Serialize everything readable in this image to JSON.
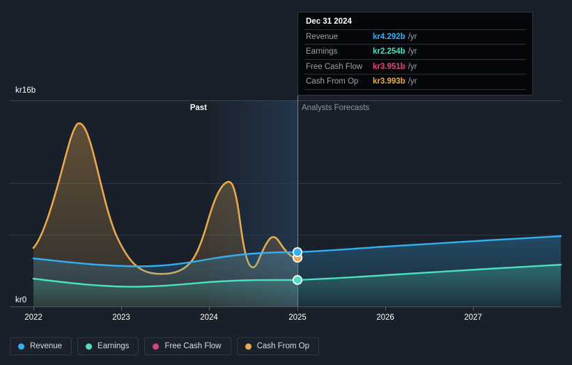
{
  "chart_data": {
    "type": "area",
    "title": "",
    "currency_prefix": "kr",
    "xlabel": "",
    "ylabel": "",
    "ylim": [
      0,
      16
    ],
    "xlim": [
      2021.75,
      2027.8
    ],
    "grid": true,
    "y_ticks": [
      {
        "value": 16,
        "label": "kr16b"
      },
      {
        "value": 0,
        "label": "kr0"
      }
    ],
    "x_ticks": [
      {
        "value": 2022,
        "label": "2022"
      },
      {
        "value": 2023,
        "label": "2023"
      },
      {
        "value": 2024,
        "label": "2024"
      },
      {
        "value": 2025,
        "label": "2025"
      },
      {
        "value": 2026,
        "label": "2026"
      },
      {
        "value": 2027,
        "label": "2027"
      }
    ],
    "divider": {
      "value": 2025,
      "past_label": "Past",
      "forecast_label": "Analysts Forecasts"
    },
    "legend_position": "bottom-left",
    "series": [
      {
        "name": "Revenue",
        "color": "#35aef2",
        "values": [
          {
            "x": 2021.93,
            "y": 3.65
          },
          {
            "x": 2022.35,
            "y": 3.5
          },
          {
            "x": 2022.8,
            "y": 3.34
          },
          {
            "x": 2023.2,
            "y": 3.3
          },
          {
            "x": 2023.6,
            "y": 3.48
          },
          {
            "x": 2024.0,
            "y": 3.76
          },
          {
            "x": 2024.5,
            "y": 4.05
          },
          {
            "x": 2025.0,
            "y": 4.292
          },
          {
            "x": 2025.6,
            "y": 4.4
          },
          {
            "x": 2026.2,
            "y": 4.62
          },
          {
            "x": 2027.0,
            "y": 4.92
          },
          {
            "x": 2027.8,
            "y": 5.2
          }
        ]
      },
      {
        "name": "Earnings",
        "color": "#4ddfc0",
        "values": [
          {
            "x": 2021.93,
            "y": 2.0
          },
          {
            "x": 2022.4,
            "y": 1.83
          },
          {
            "x": 2022.9,
            "y": 1.74
          },
          {
            "x": 2023.4,
            "y": 1.76
          },
          {
            "x": 2023.9,
            "y": 1.88
          },
          {
            "x": 2024.4,
            "y": 2.02
          },
          {
            "x": 2025.0,
            "y": 2.254
          },
          {
            "x": 2025.7,
            "y": 2.33
          },
          {
            "x": 2026.4,
            "y": 2.47
          },
          {
            "x": 2027.2,
            "y": 2.67
          },
          {
            "x": 2027.8,
            "y": 2.82
          }
        ]
      },
      {
        "name": "Free Cash Flow",
        "color": "#d6457f",
        "values": [
          {
            "x": 2025.0,
            "y": 3.951
          }
        ]
      },
      {
        "name": "Cash From Op",
        "color": "#e8a94f",
        "values": [
          {
            "x": 2021.93,
            "y": 4.55
          },
          {
            "x": 2022.1,
            "y": 6.2
          },
          {
            "x": 2022.28,
            "y": 12.55
          },
          {
            "x": 2022.45,
            "y": 11.2
          },
          {
            "x": 2022.7,
            "y": 7.9
          },
          {
            "x": 2022.95,
            "y": 4.2
          },
          {
            "x": 2023.15,
            "y": 2.55
          },
          {
            "x": 2023.45,
            "y": 2.52
          },
          {
            "x": 2023.72,
            "y": 3.6
          },
          {
            "x": 2023.95,
            "y": 7.8
          },
          {
            "x": 2024.1,
            "y": 9.5
          },
          {
            "x": 2024.26,
            "y": 9.7
          },
          {
            "x": 2024.38,
            "y": 7.2
          },
          {
            "x": 2024.52,
            "y": 3.3
          },
          {
            "x": 2024.6,
            "y": 2.95
          },
          {
            "x": 2024.76,
            "y": 5.2
          },
          {
            "x": 2024.88,
            "y": 4.6
          },
          {
            "x": 2025.0,
            "y": 3.993
          }
        ]
      }
    ],
    "markers": [
      {
        "series": "Revenue",
        "x": 2025,
        "y": 4.292,
        "color": "#35aef2"
      },
      {
        "series": "Cash From Op",
        "x": 2025,
        "y": 3.993,
        "color": "#e8a94f"
      },
      {
        "series": "Earnings",
        "x": 2025,
        "y": 2.254,
        "color": "#4ddfc0"
      }
    ]
  },
  "tooltip": {
    "title": "Dec 31 2024",
    "unit": "/yr",
    "rows": [
      {
        "label": "Revenue",
        "value": "kr4.292b",
        "color": "#35aef2"
      },
      {
        "label": "Earnings",
        "value": "kr2.254b",
        "color": "#4ddfc0"
      },
      {
        "label": "Free Cash Flow",
        "value": "kr3.951b",
        "color": "#ea3e8b"
      },
      {
        "label": "Cash From Op",
        "value": "kr3.993b",
        "color": "#e8a94f"
      }
    ]
  },
  "legend": {
    "items": [
      {
        "label": "Revenue",
        "color": "#35aef2"
      },
      {
        "label": "Earnings",
        "color": "#4ddfc0"
      },
      {
        "label": "Free Cash Flow",
        "color": "#d6457f"
      },
      {
        "label": "Cash From Op",
        "color": "#e8a94f"
      }
    ]
  },
  "theme": {
    "background": "#1a2029",
    "gridline": "#2f3741",
    "axis_text": "#ffffff",
    "muted_text": "#8e98a6"
  }
}
